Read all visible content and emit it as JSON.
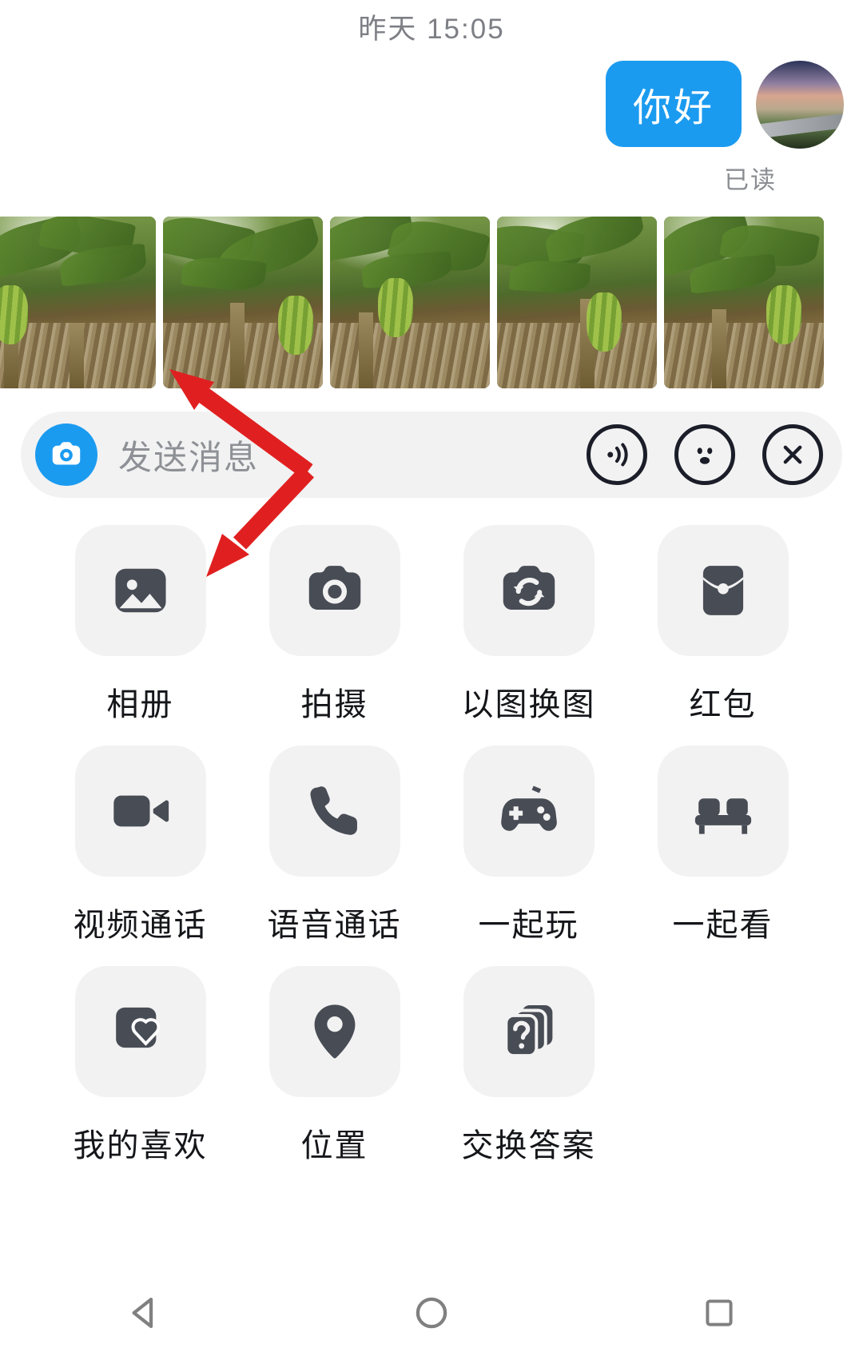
{
  "conversation": {
    "timestamp": "昨天 15:05",
    "message": {
      "text": "你好",
      "bubble_color": "#1b9bf0",
      "status": "已读"
    },
    "avatar_name": "user-avatar"
  },
  "photo_strip": {
    "name": "banana-grove-photos",
    "count": 5,
    "items": [
      {
        "alt": "banana-plantation-1"
      },
      {
        "alt": "banana-plantation-2"
      },
      {
        "alt": "banana-plantation-3"
      },
      {
        "alt": "banana-plantation-4"
      },
      {
        "alt": "banana-plantation-5"
      }
    ]
  },
  "input_bar": {
    "placeholder": "发送消息",
    "camera_icon": "camera-circle-icon",
    "accent_color": "#1b9bf0",
    "actions": [
      {
        "icon": "voice-wave-icon"
      },
      {
        "icon": "emoji-face-icon"
      },
      {
        "icon": "close-x-icon"
      }
    ]
  },
  "panel": {
    "rows": [
      [
        {
          "label": "相册",
          "icon": "photo-album-icon"
        },
        {
          "label": "拍摄",
          "icon": "camera-icon"
        },
        {
          "label": "以图换图",
          "icon": "photo-swap-icon"
        },
        {
          "label": "红包",
          "icon": "red-packet-icon"
        }
      ],
      [
        {
          "label": "视频通话",
          "icon": "video-call-icon"
        },
        {
          "label": "语音通话",
          "icon": "phone-call-icon"
        },
        {
          "label": "一起玩",
          "icon": "gamepad-icon"
        },
        {
          "label": "一起看",
          "icon": "sofa-icon"
        }
      ],
      [
        {
          "label": "我的喜欢",
          "icon": "favorite-heart-icon"
        },
        {
          "label": "位置",
          "icon": "location-pin-icon"
        },
        {
          "label": "交换答案",
          "icon": "question-cards-icon"
        }
      ]
    ],
    "tile_color": "#f2f2f2",
    "icon_color": "#484c55"
  },
  "annotation": {
    "arrow_color": "#e02020",
    "arrows": [
      {
        "name": "arrow-to-photo-strip"
      },
      {
        "name": "arrow-to-album-tile"
      }
    ]
  },
  "navbar": {
    "items": [
      {
        "icon": "back-triangle-icon"
      },
      {
        "icon": "home-circle-icon"
      },
      {
        "icon": "recents-square-icon"
      }
    ]
  }
}
